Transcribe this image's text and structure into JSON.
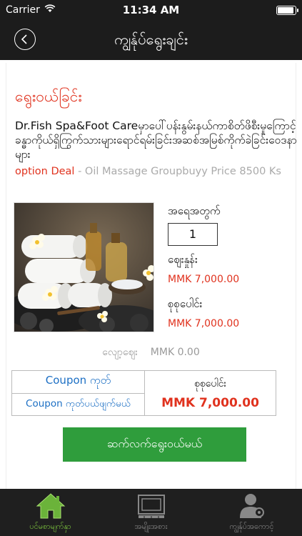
{
  "status_bar": {
    "carrier": "Carrier",
    "time": "11:34 AM"
  },
  "nav": {
    "title": "ကျွန်ုပ်ရွေးချင်း"
  },
  "deal": {
    "section_title": "ရွေးဝယ်ခြင်း",
    "title": "Dr.Fish Spa&Foot Careမှာပေါ်ပန်းနွမ်းနယ်ကာစိတ်ဖိစီးမှုကြောင့်ခန္ဓာကိုယ်ရှိကြွက်သားများရောင်ရမ်းခြင်းအဆစ်အမြစ်ကိုက်ခဲခြင်းဝေဒနာများ",
    "subtitle_highlight": "option Deal",
    "subtitle_rest": " - Oil Massage Groupbuyy Price 8500 Ks"
  },
  "order": {
    "quantity_label": "အရေအတွက်",
    "quantity_value": "1",
    "price_label": "ဈေးနှုန်း",
    "price_value": "MMK 7,000.00",
    "total_label": "စုစုပေါင်း",
    "total_value": "MMK 7,000.00",
    "discount_label": "လျော့ဈေး",
    "discount_value": "MMK 0.00"
  },
  "coupon": {
    "coupon_code": "Coupon ကုတ်",
    "coupon_remove": "Coupon ကုတ်ပယ်ဖျက်မယ်",
    "grand_total_label": "စုစုပေါင်း",
    "grand_total_value": "MMK 7,000.00"
  },
  "checkout_label": "ဆက်လက်ရွေးဝယ်မယ်",
  "tabs": [
    {
      "label": "ပင်မစာမျက်နှာ",
      "icon": "home-icon",
      "active": true
    },
    {
      "label": "အမျိုးအစား",
      "icon": "categories-icon",
      "active": false
    },
    {
      "label": "ကျွန်ုပ်အကောင့်",
      "icon": "account-icon",
      "active": false
    }
  ],
  "colors": {
    "accent": "#e0321e",
    "link": "#1c6fc4",
    "button": "#2f9d3c",
    "bar": "#1c1c1c",
    "tab_active": "#7ec63e"
  }
}
